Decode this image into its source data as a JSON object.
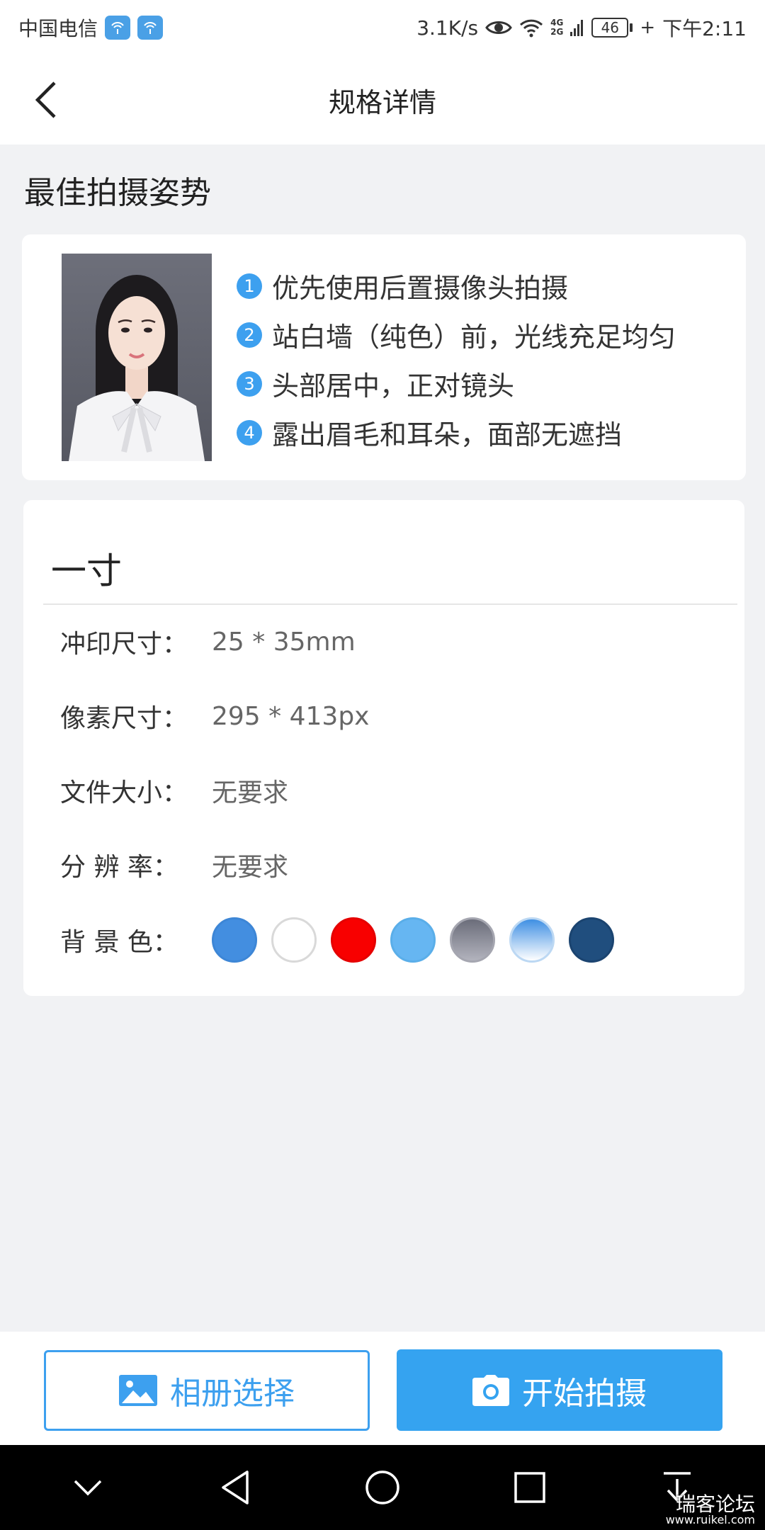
{
  "status_bar": {
    "carrier": "中国电信",
    "net_speed": "3.1K/s",
    "network": "4G",
    "network2": "2G",
    "battery": "46",
    "time": "下午2:11"
  },
  "header": {
    "title": "规格详情"
  },
  "pose_section": {
    "title": "最佳拍摄姿势",
    "tips": [
      {
        "num": "1",
        "text": "优先使用后置摄像头拍摄"
      },
      {
        "num": "2",
        "text": "站白墙（纯色）前，光线充足均匀"
      },
      {
        "num": "3",
        "text": "头部居中，正对镜头"
      },
      {
        "num": "4",
        "text": "露出眉毛和耳朵，面部无遮挡"
      }
    ]
  },
  "spec": {
    "title": "一寸",
    "print_size_label": "冲印尺寸：",
    "print_size_value": "25 * 35mm",
    "pixel_size_label": "像素尺寸：",
    "pixel_size_value": "295 * 413px",
    "file_size_label": "文件大小：",
    "file_size_value": "无要求",
    "resolution_label": "分 辨 率：",
    "resolution_value": "无要求",
    "bg_color_label": "背 景 色："
  },
  "background_colors": [
    {
      "name": "blue",
      "fill": "#438ee0",
      "border": "#3d86d6"
    },
    {
      "name": "white",
      "fill": "#ffffff",
      "border": "#d9d9d9"
    },
    {
      "name": "red",
      "fill": "#f80000",
      "border": "#e50000"
    },
    {
      "name": "light-blue",
      "fill": "#66b6f2",
      "border": "#5aaee9"
    },
    {
      "name": "gray-gradient",
      "fill": "linear-gradient(#6b6d7a, #b2b3bd)",
      "border": "#a5a6b0"
    },
    {
      "name": "blue-gradient",
      "fill": "linear-gradient(#3f8fe3, #ffffff)",
      "border": "#bcd8f3"
    },
    {
      "name": "dark-blue",
      "fill": "#204e7e",
      "border": "#1b4470"
    }
  ],
  "actions": {
    "album_label": "相册选择",
    "shoot_label": "开始拍摄"
  },
  "colors": {
    "accent": "#35a3f0",
    "page_bg": "#f1f2f4"
  },
  "watermark": {
    "text": "瑞客论坛",
    "site": "www.ruikel.com"
  }
}
